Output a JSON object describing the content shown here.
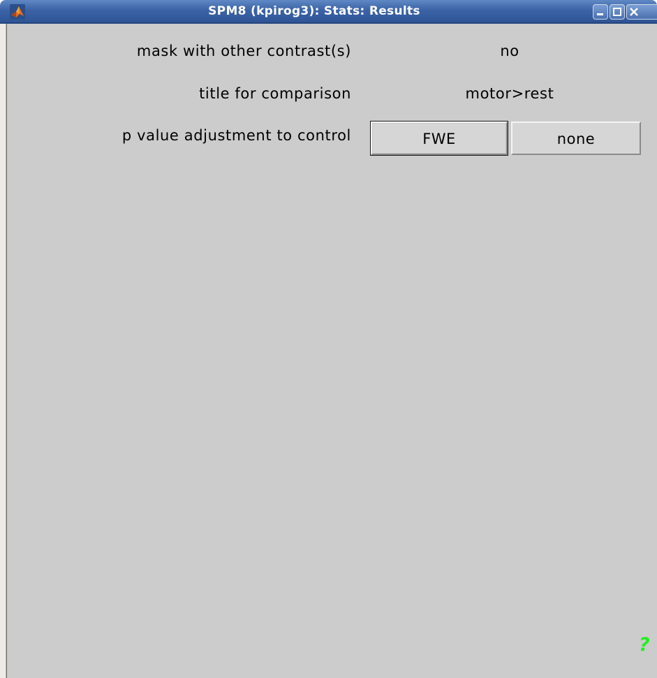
{
  "window": {
    "title": "SPM8 (kpirog3): Stats: Results",
    "app_icon": "matlab-icon",
    "controls": [
      "minimize-icon",
      "maximize-icon",
      "close-icon"
    ]
  },
  "prompts": [
    {
      "label": "mask with other contrast(s)",
      "value": "no"
    },
    {
      "label": "title for comparison",
      "value": "motor>rest"
    },
    {
      "label": "p value adjustment to control"
    }
  ],
  "buttons": {
    "fwe": "FWE",
    "none": "none"
  },
  "help": {
    "label": "?",
    "color": "#22ee22"
  }
}
